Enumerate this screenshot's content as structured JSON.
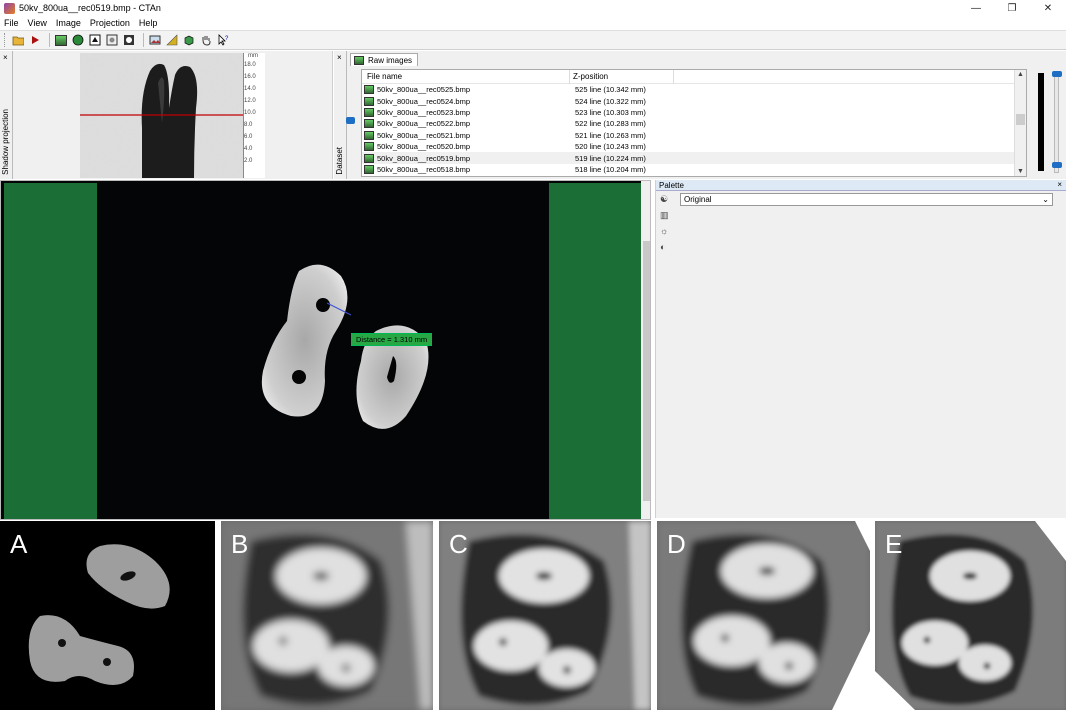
{
  "window": {
    "title": "50kv_800ua__rec0519.bmp - CTAn",
    "controls": {
      "minimize": "—",
      "restore": "❐",
      "close": "✕"
    }
  },
  "menu": [
    "File",
    "View",
    "Image",
    "Projection",
    "Help"
  ],
  "toolbar": {
    "icons": [
      "open-folder-icon",
      "play-icon",
      "raw-images-icon",
      "preview-icon",
      "binary-icon",
      "roi-icon",
      "morphology-icon",
      "image-icon",
      "histogram-icon",
      "3d-model-icon",
      "pan-hand-icon",
      "help-pointer-icon"
    ]
  },
  "shadow_projection": {
    "label": "Shadow projection",
    "close": "×",
    "ruler_unit": "mm",
    "ruler_ticks": [
      "18.0",
      "16.0",
      "14.0",
      "12.0",
      "10.0",
      "8.0",
      "6.0",
      "4.0",
      "2.0"
    ],
    "position_fraction": 0.5
  },
  "dataset": {
    "label": "Dataset",
    "close": "×",
    "tab": "Raw images",
    "columns": [
      "File name",
      "Z-position"
    ],
    "rows": [
      {
        "name": "50kv_800ua__rec0525.bmp",
        "z": "525 line (10.342 mm)"
      },
      {
        "name": "50kv_800ua__rec0524.bmp",
        "z": "524 line (10.322 mm)"
      },
      {
        "name": "50kv_800ua__rec0523.bmp",
        "z": "523 line (10.303 mm)"
      },
      {
        "name": "50kv_800ua__rec0522.bmp",
        "z": "522 line (10.283 mm)"
      },
      {
        "name": "50kv_800ua__rec0521.bmp",
        "z": "521 line (10.263 mm)"
      },
      {
        "name": "50kv_800ua__rec0520.bmp",
        "z": "520 line (10.243 mm)"
      },
      {
        "name": "50kv_800ua__rec0519.bmp",
        "z": "519 line (10.224 mm)",
        "selected": true
      },
      {
        "name": "50kv_800ua__rec0518.bmp",
        "z": "518 line (10.204 mm)"
      }
    ],
    "scroll_up": "▲",
    "scroll_down": "▼"
  },
  "main_view": {
    "distance_label": "Distance = 1.310 mm"
  },
  "palette": {
    "title": "Palette",
    "close": "×",
    "selected": "Original",
    "dropdown_arrow": "⌄",
    "tool_icons": [
      "palette-icon",
      "contrast-icon",
      "brightness-icon",
      "gamma-icon"
    ]
  },
  "panels": [
    {
      "letter": "A"
    },
    {
      "letter": "B"
    },
    {
      "letter": "C"
    },
    {
      "letter": "D"
    },
    {
      "letter": "E"
    }
  ],
  "colors": {
    "accent_blue": "#1e6fc4",
    "measure_green": "#28a745",
    "background_green": "#1a6e36",
    "scan_line_red": "#c00000"
  }
}
